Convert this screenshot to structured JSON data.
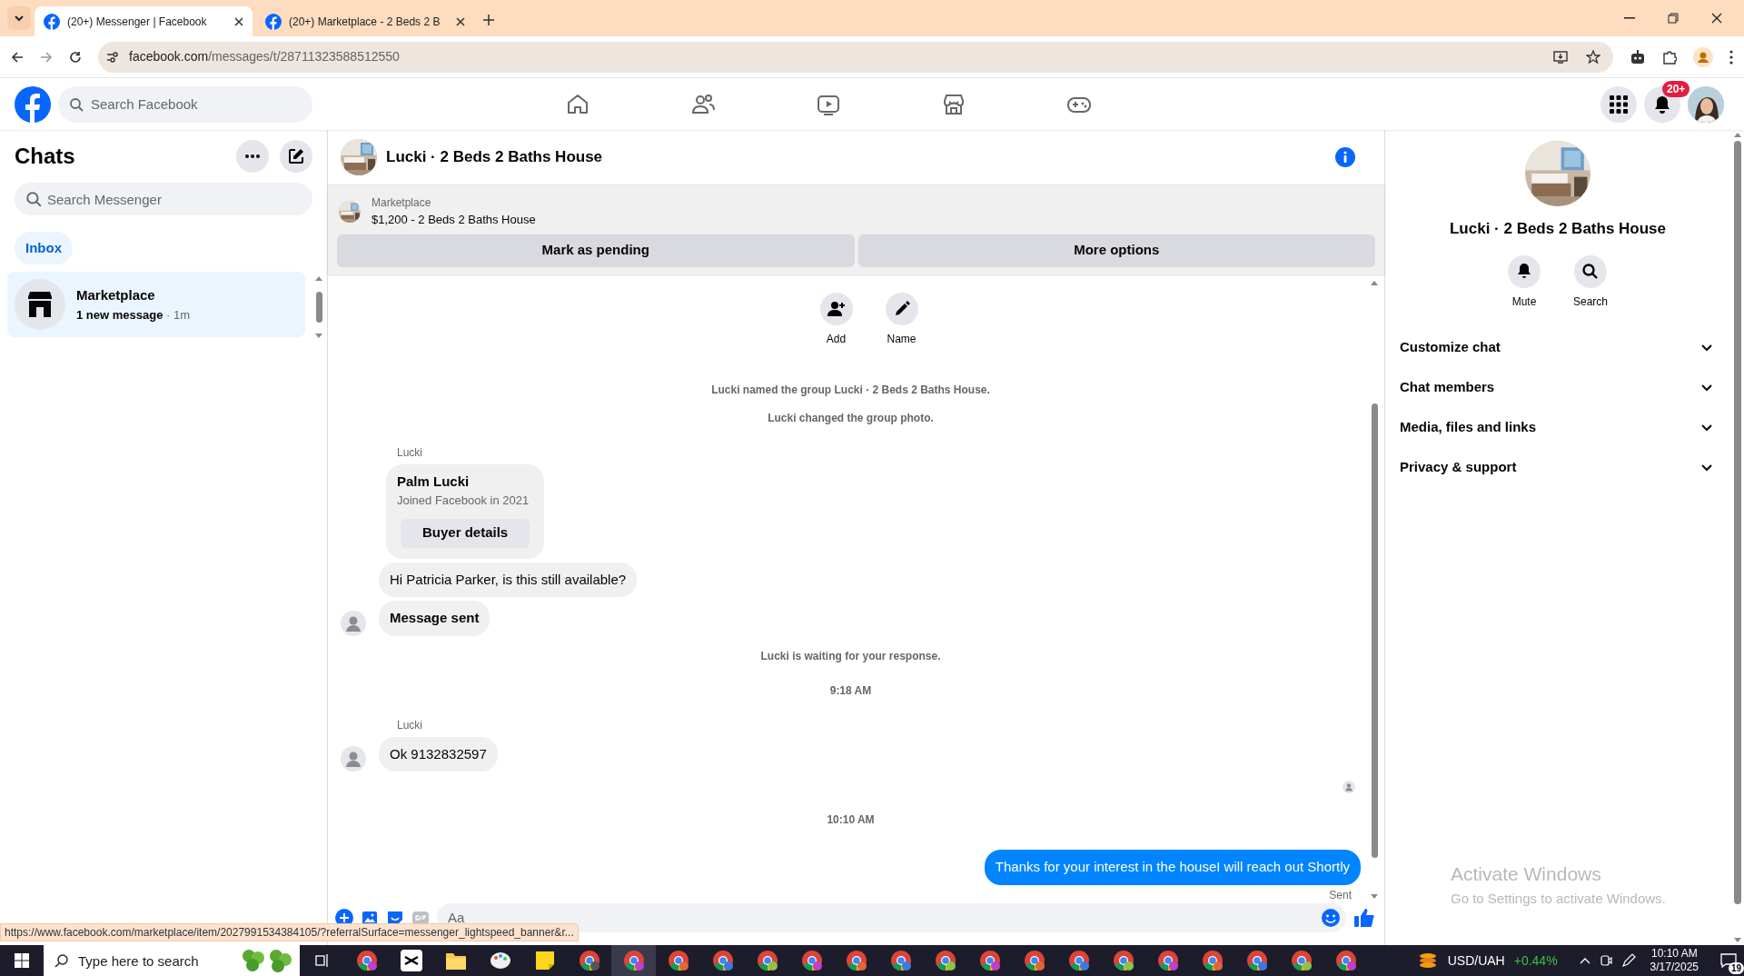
{
  "browser": {
    "tabs": [
      {
        "title": "(20+) Messenger | Facebook",
        "selected": true
      },
      {
        "title": "(20+) Marketplace - 2 Beds 2 B",
        "selected": false
      }
    ],
    "url_host": "facebook.com",
    "url_path": "/messages/t/28711323588512550",
    "status_url": "https://www.facebook.com/marketplace/item/2027991534384105/?referralSurface=messenger_lightspeed_banner&r..."
  },
  "topbar": {
    "search_placeholder": "Search Facebook",
    "notification_badge": "20+"
  },
  "sidebar": {
    "title": "Chats",
    "search_placeholder": "Search Messenger",
    "filters": [
      {
        "label": "Inbox",
        "selected": true
      }
    ],
    "chats": [
      {
        "name": "Marketplace",
        "preview": "1 new message",
        "time": " · 1m",
        "unread": true,
        "selected": true
      }
    ]
  },
  "chat": {
    "title": "Lucki · 2 Beds 2 Baths House",
    "listing": {
      "label": "Marketplace",
      "title": "$1,200 - 2 Beds 2 Baths House"
    },
    "actions": [
      "Mark as pending",
      "More options"
    ],
    "group_actions": [
      {
        "kind": "add",
        "label": "Add"
      },
      {
        "kind": "name",
        "label": "Name"
      }
    ],
    "messages": [
      {
        "kind": "system",
        "text": "Lucki named the group Lucki · 2 Beds 2 Baths House."
      },
      {
        "kind": "system",
        "text": "Lucki changed the group photo."
      },
      {
        "kind": "sender",
        "text": "Lucki"
      },
      {
        "kind": "card",
        "name": "Palm Lucki",
        "detail": "Joined Facebook in 2021",
        "button": "Buyer details"
      },
      {
        "kind": "incoming",
        "text": "Hi Patricia Parker, is this still available?",
        "bold": false,
        "avatar": false
      },
      {
        "kind": "incoming",
        "text": "Message sent",
        "bold": true,
        "avatar": true
      },
      {
        "kind": "system",
        "text": "Lucki is waiting for your response."
      },
      {
        "kind": "timestamp",
        "text": "9:18 AM"
      },
      {
        "kind": "sender",
        "text": "Lucki"
      },
      {
        "kind": "incoming",
        "text": "Ok 9132832597",
        "bold": false,
        "avatar": true
      },
      {
        "kind": "seen"
      },
      {
        "kind": "timestamp",
        "text": "10:10 AM"
      },
      {
        "kind": "outgoing",
        "text": "Thanks for your interest in the houseI will reach out Shortly"
      },
      {
        "kind": "status",
        "text": "Sent"
      }
    ],
    "composer_placeholder": "Aa"
  },
  "details": {
    "title": "Lucki · 2 Beds 2 Baths House",
    "actions": [
      {
        "kind": "mute",
        "label": "Mute"
      },
      {
        "kind": "search",
        "label": "Search"
      }
    ],
    "sections": [
      "Customize chat",
      "Chat members",
      "Media, files and links",
      "Privacy & support"
    ]
  },
  "activation": {
    "title": "Activate Windows",
    "subtitle": "Go to Settings to activate Windows."
  },
  "taskbar": {
    "search_placeholder": "Type here to search",
    "ticker": {
      "pair": "USD/UAH",
      "change": "+0.44%"
    },
    "time": "10:10 AM",
    "date": "3/17/2025",
    "notifications": "19"
  }
}
